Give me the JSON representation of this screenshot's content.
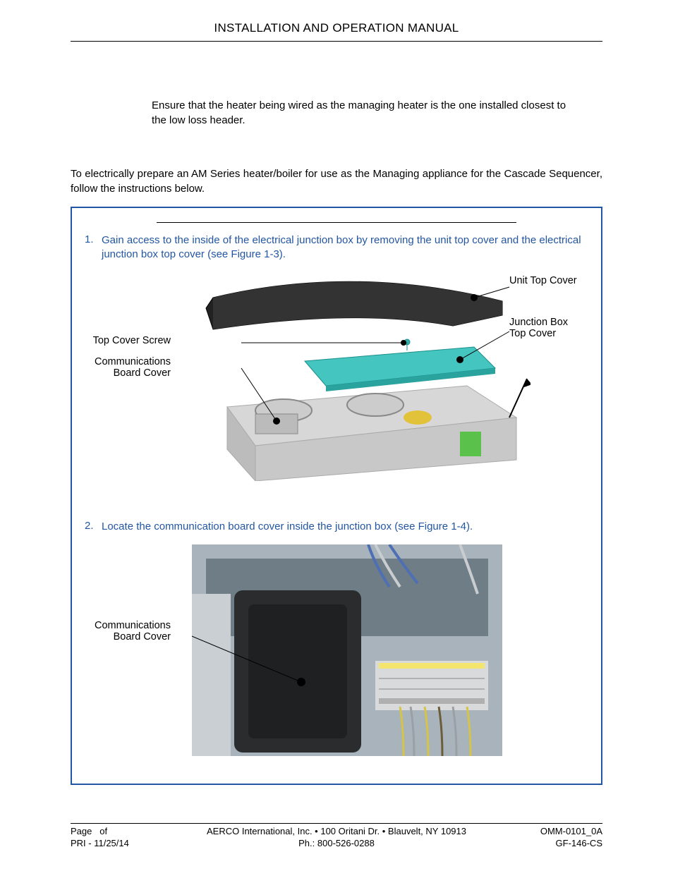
{
  "header": {
    "title": "INSTALLATION AND OPERATION MANUAL"
  },
  "note": "Ensure that the heater being wired as the managing heater is the one installed closest to the low loss header.",
  "intro": "To electrically prepare an AM Series heater/boiler for use as the Managing appliance for the Cascade Sequencer, follow the instructions below.",
  "steps": [
    {
      "num": "1.",
      "text": "Gain access to the inside of the electrical junction box by removing the unit top cover and the electrical junction box top cover (see Figure 1-3)."
    },
    {
      "num": "2.",
      "text": "Locate the communication board cover inside the junction box (see Figure 1-4)."
    }
  ],
  "figure1": {
    "labels": {
      "unit_top_cover": "Unit Top Cover",
      "junction_box_top_cover_l1": "Junction Box",
      "junction_box_top_cover_l2": "Top Cover",
      "top_cover_screw": "Top Cover Screw",
      "communications_l1": "Communications",
      "communications_l2": "Board Cover"
    }
  },
  "figure2": {
    "labels": {
      "communications_l1": "Communications",
      "communications_l2": "Board Cover"
    }
  },
  "footer": {
    "page_prefix": "Page",
    "page_of": "of",
    "pri_date": "PRI - 11/25/14",
    "company_line": "AERCO International, Inc. • 100 Oritani Dr. • Blauvelt, NY 10913",
    "phone": "Ph.: 800-526-0288",
    "doc_no": "OMM-0101_0A",
    "doc_ref": "GF-146-CS"
  }
}
